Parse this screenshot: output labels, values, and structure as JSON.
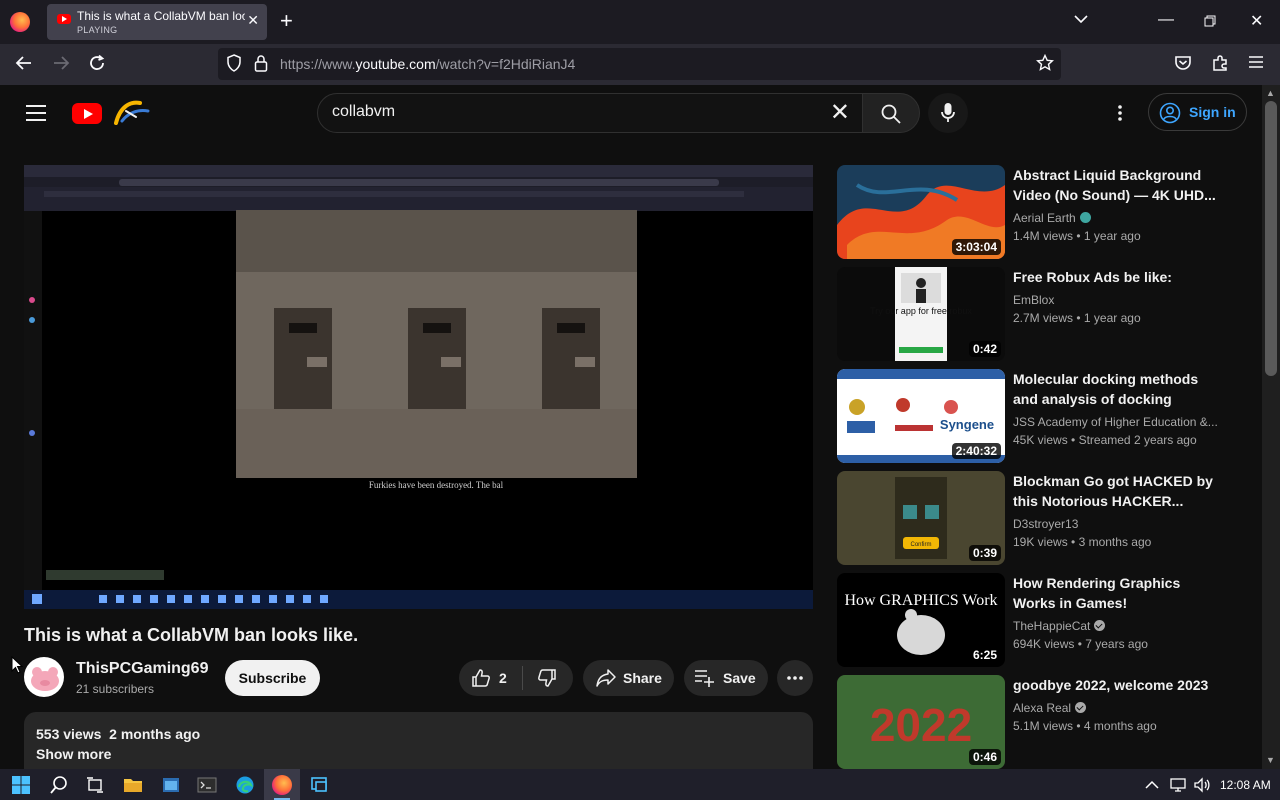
{
  "browser": {
    "tab_title": "This is what a CollabVM ban looks like. - YouTube",
    "tab_status": "PLAYING",
    "url_prefix": "https://www.",
    "url_host": "youtube.com",
    "url_path": "/watch?v=f2HdiRianJ4"
  },
  "youtube": {
    "search_query": "collabvm",
    "sign_in_label": "Sign in"
  },
  "video": {
    "title": "This is what a CollabVM ban looks like.",
    "channel": "ThisPCGaming69",
    "subscribers": "21 subscribers",
    "subscribe_label": "Subscribe",
    "likes": "2",
    "share_label": "Share",
    "save_label": "Save",
    "views": "553 views",
    "age": "2 months ago",
    "show_more": "Show more",
    "frame_caption": "Furkies have been destroyed. The bal"
  },
  "recommendations": [
    {
      "title": "Abstract Liquid Background Video (No Sound) — 4K UHD...",
      "channel": "Aerial Earth",
      "badge": "globe",
      "views": "1.4M views",
      "age": "1 year ago",
      "duration": "3:03:04"
    },
    {
      "title": "Free Robux Ads be like:",
      "channel": "EmBlox",
      "badge": "",
      "views": "2.7M views",
      "age": "1 year ago",
      "duration": "0:42",
      "thumb_text": "Try our app for free robux"
    },
    {
      "title": "Molecular docking methods and analysis of docking",
      "channel": "JSS Academy of Higher Education &...",
      "badge": "",
      "views": "45K views",
      "age": "Streamed 2 years ago",
      "duration": "2:40:32",
      "thumb_text": "Syngene"
    },
    {
      "title": "Blockman Go got HACKED by this Notorious HACKER...",
      "channel": "D3stroyer13",
      "badge": "",
      "views": "19K views",
      "age": "3 months ago",
      "duration": "0:39",
      "thumb_text": "Confirm"
    },
    {
      "title": "How Rendering Graphics Works in Games!",
      "channel": "TheHappieCat",
      "badge": "verified",
      "views": "694K views",
      "age": "7 years ago",
      "duration": "6:25",
      "thumb_text": "How GRAPHICS Work"
    },
    {
      "title": "goodbye 2022, welcome 2023",
      "channel": "Alexa Real",
      "badge": "verified",
      "views": "5.1M views",
      "age": "4 months ago",
      "duration": "0:46",
      "thumb_text": "2022"
    }
  ],
  "taskbar": {
    "time": "12:08 AM"
  }
}
